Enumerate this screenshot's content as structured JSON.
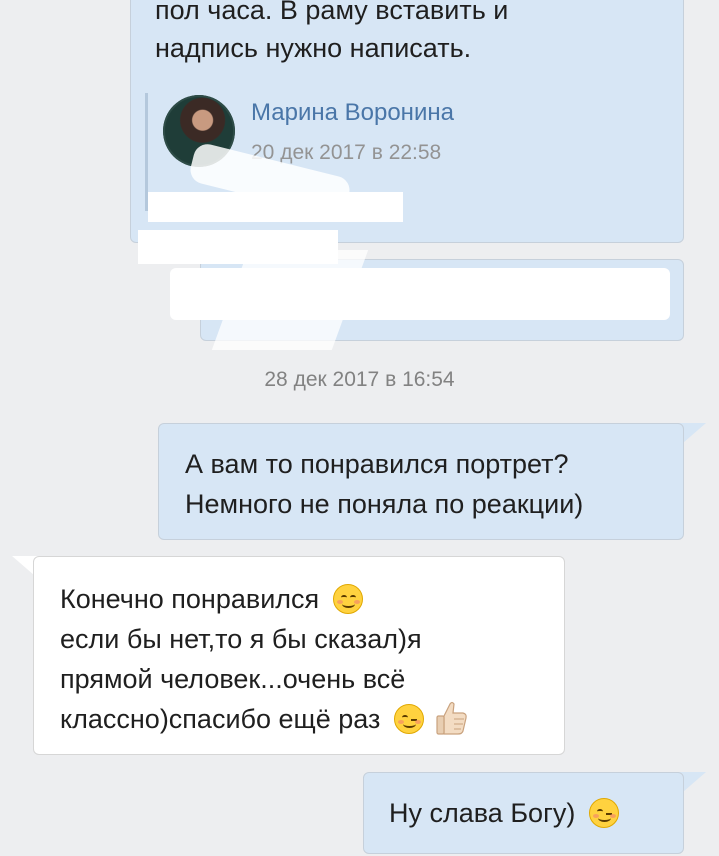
{
  "messages": {
    "m1": {
      "lines": [
        "пол часа. В раму вставить и",
        "надпись нужно написать."
      ],
      "forward": {
        "author": "Марина Воронина",
        "time": "20 дек 2017 в 22:58"
      }
    },
    "date_separator": "28 дек 2017 в 16:54",
    "m3": {
      "lines": [
        "А вам то понравился портрет?",
        "Немного не поняла по реакции)"
      ]
    },
    "m4": {
      "lines": [
        "Конечно понравился",
        "если бы нет,то я бы сказал)я",
        "прямой человек...очень всё",
        "классно)спасибо ещё раз"
      ]
    },
    "m5": {
      "lines": [
        "Ну слава Богу)"
      ]
    }
  },
  "colors": {
    "background": "#edeef0",
    "outgoing_bubble": "#d7e6f5",
    "incoming_bubble": "#ffffff",
    "forward_author": "#4a76a8",
    "timestamp": "#939393"
  },
  "icons": [
    "smiling-face-emoji",
    "winking-face-emoji",
    "thumbs-up-emoji"
  ]
}
